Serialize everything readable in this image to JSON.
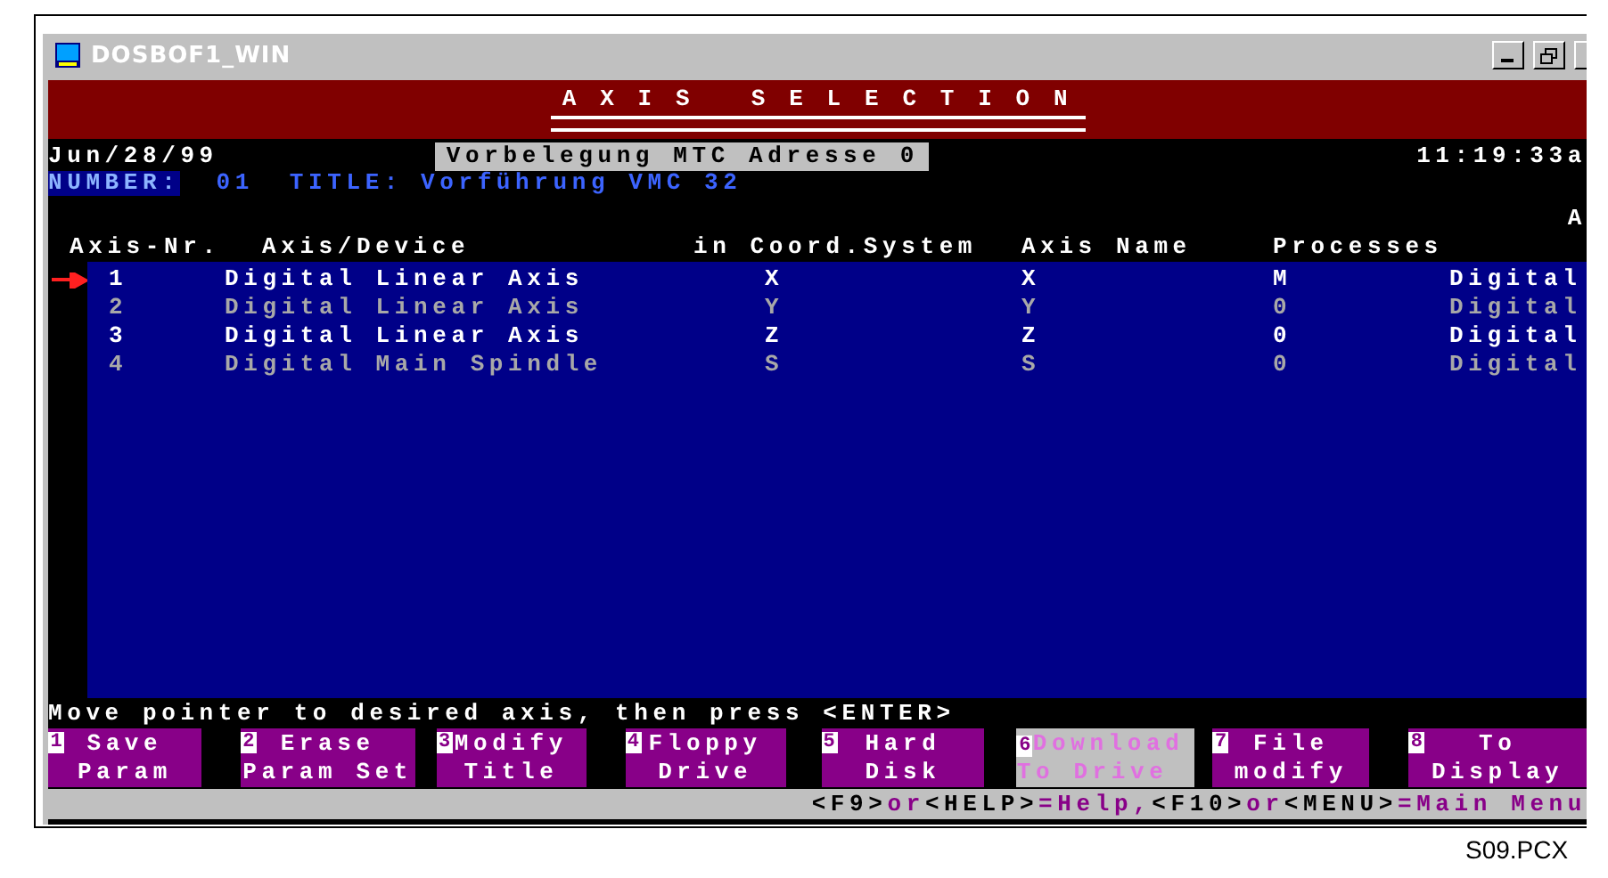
{
  "window": {
    "title": "DOSBOF1_WIN"
  },
  "header": {
    "title": "A X I S   S E L E C T I O N",
    "date": "Jun/28/99",
    "preset": "Vorbelegung MTC Adresse 0",
    "time": "11:19:33a"
  },
  "info": {
    "number_label": "NUMBER:",
    "number": "01",
    "title_label": "TITLE:",
    "title": "Vorführung VMC 32"
  },
  "table": {
    "column_6_header": "A",
    "columns": [
      "Axis-Nr.",
      "Axis/Device",
      "in Coord.System",
      "Axis Name",
      "Processes"
    ],
    "rows": [
      {
        "selected": true,
        "bright": true,
        "number": "1",
        "device": "Digital Linear Axis",
        "coord": "X",
        "axis_name": "X",
        "processes": "M",
        "column_6": "Digital"
      },
      {
        "selected": false,
        "bright": false,
        "number": "2",
        "device": "Digital Linear Axis",
        "coord": "Y",
        "axis_name": "Y",
        "processes": "0",
        "column_6": "Digital"
      },
      {
        "selected": false,
        "bright": true,
        "number": "3",
        "device": "Digital Linear Axis",
        "coord": "Z",
        "axis_name": "Z",
        "processes": "0",
        "column_6": "Digital"
      },
      {
        "selected": false,
        "bright": false,
        "number": "4",
        "device": "Digital Main Spindle",
        "coord": "S",
        "axis_name": "S",
        "processes": "0",
        "column_6": "Digital"
      }
    ]
  },
  "message": "Move pointer to desired axis, then press <ENTER>",
  "function_keys": [
    {
      "key": "1",
      "line1": "Save",
      "line2": "Param",
      "selected": false
    },
    {
      "key": "2",
      "line1": "Erase",
      "line2": "Param Set",
      "selected": false
    },
    {
      "key": "3",
      "line1": "Modify",
      "line2": "Title",
      "selected": false
    },
    {
      "key": "4",
      "line1": "Floppy",
      "line2": "Drive",
      "selected": false
    },
    {
      "key": "5",
      "line1": "Hard",
      "line2": "Disk",
      "selected": false
    },
    {
      "key": "6",
      "line1": "Download",
      "line2": "To Drive",
      "selected": true
    },
    {
      "key": "7",
      "line1": "File",
      "line2": "modify",
      "selected": false
    },
    {
      "key": "8",
      "line1": "To",
      "line2": "Display",
      "selected": false
    }
  ],
  "status_bar": [
    {
      "kind": "key",
      "text": "<F9>"
    },
    {
      "kind": "text",
      "text": "or"
    },
    {
      "kind": "key",
      "text": "<HELP>"
    },
    {
      "kind": "text",
      "text": "=Help,"
    },
    {
      "kind": "key",
      "text": "<F10>"
    },
    {
      "kind": "text",
      "text": "or"
    },
    {
      "kind": "key",
      "text": "<MENU>"
    },
    {
      "kind": "text",
      "text": "=Main Menu"
    }
  ],
  "caption": "S09.PCX"
}
